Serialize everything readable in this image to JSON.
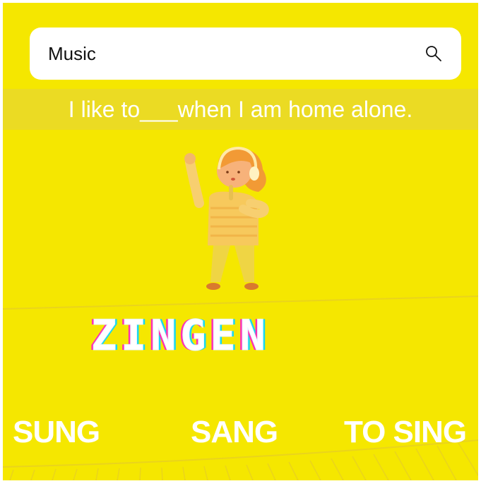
{
  "search": {
    "query": "Music",
    "icon": "search-icon"
  },
  "prompt": {
    "sentence": "I like to___when I am home alone."
  },
  "illustration": {
    "subject": "girl-singing-with-headphones"
  },
  "word": {
    "text": "ZINGEN"
  },
  "options": [
    {
      "label": "SUNG"
    },
    {
      "label": "SANG"
    },
    {
      "label": "TO SING"
    }
  ],
  "colors": {
    "background": "#f5e700",
    "band": "#ebdb23",
    "word_shadow_pink": "#ff2fb4",
    "word_shadow_cyan": "#18d8f0"
  }
}
